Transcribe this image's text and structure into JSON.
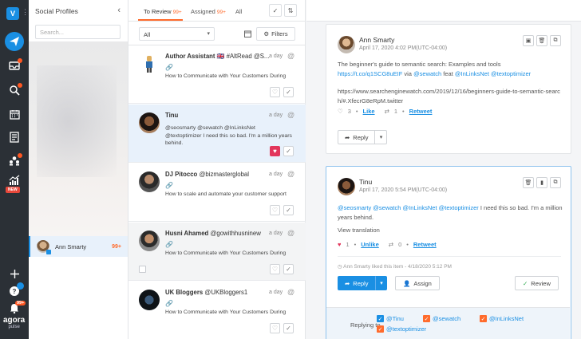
{
  "app": {
    "account_initial": "V",
    "new_badge": "NEW",
    "logo_word": "agora",
    "logo_sub": "pulse",
    "notif_count": "99+",
    "colors": {
      "accent": "#1a8fe3",
      "orange": "#ff6b2c",
      "rail": "#2b3036"
    }
  },
  "profiles": {
    "title": "Social Profiles",
    "search_placeholder": "Search...",
    "selected": {
      "name": "Ann Smarty",
      "count": "99+"
    }
  },
  "inbox": {
    "tabs": [
      {
        "label": "To Review",
        "count": "99+"
      },
      {
        "label": "Assigned",
        "count": "99+"
      },
      {
        "label": "All",
        "count": ""
      }
    ],
    "filter_select": "All",
    "filters_label": "Filters",
    "messages": [
      {
        "name": "Author Assistant",
        "handle": "🇬🇧 #AltRead @S...",
        "time": "a day",
        "text": "How to Communicate with Your Customers During"
      },
      {
        "name": "Tinu",
        "handle": "",
        "time": "a day",
        "text": "@seosmarty @sewatch @InLinksNet @textoptimizer I need this so bad. I'm a million years behind."
      },
      {
        "name": "DJ Pitocco",
        "handle": "@bizmasterglobal",
        "time": "a day",
        "text": "How to scale and automate your customer support"
      },
      {
        "name": "Husni Ahamed",
        "handle": "@gowithhusninew",
        "time": "a day",
        "text": "How to Communicate with Your Customers During"
      },
      {
        "name": "UK Bloggers",
        "handle": "@UKBloggers1",
        "time": "a day",
        "text": "How to Communicate with Your Customers During"
      }
    ]
  },
  "detail": {
    "post": {
      "name": "Ann Smarty",
      "date": "April 17, 2020 4:02 PM(UTC-04:00)",
      "text_pre": "The beginner's guide to semantic search: Examples and tools ",
      "link1": "https://t.co/q1SCG8uEIF",
      "text_via": " via ",
      "mention1": "@sewatch",
      "text_feat": " feat ",
      "mention2": "@InLinksNet",
      "mention3": "@textoptimizer",
      "url": "https://www.searchenginewatch.com/2019/12/16/beginners-guide-to-semantic-search/#.XfecrG8eRpM.twitter",
      "likes": "3",
      "like_label": "Like",
      "retweets": "1",
      "retweet_label": "Retweet",
      "reply_label": "Reply"
    },
    "reply": {
      "name": "Tinu",
      "date": "April 17, 2020 5:54 PM(UTC-04:00)",
      "mentions": "@seosmarty @sewatch @InLinksNet @textoptimizer",
      "text": " I need this so bad. I'm a million years behind.",
      "view_translation": "View translation",
      "likes": "1",
      "unlike_label": "Unlike",
      "retweets": "0",
      "retweet_label": "Retweet",
      "liked_line": "Ann Smarty liked this item - 4/18/2020 5:12 PM",
      "reply_label": "Reply",
      "assign_label": "Assign",
      "review_label": "Review",
      "replying_to_label": "Replying to",
      "replying_to": [
        "@Tinu",
        "@sewatch",
        "@InLinksNet",
        "@textoptimizer"
      ]
    }
  }
}
